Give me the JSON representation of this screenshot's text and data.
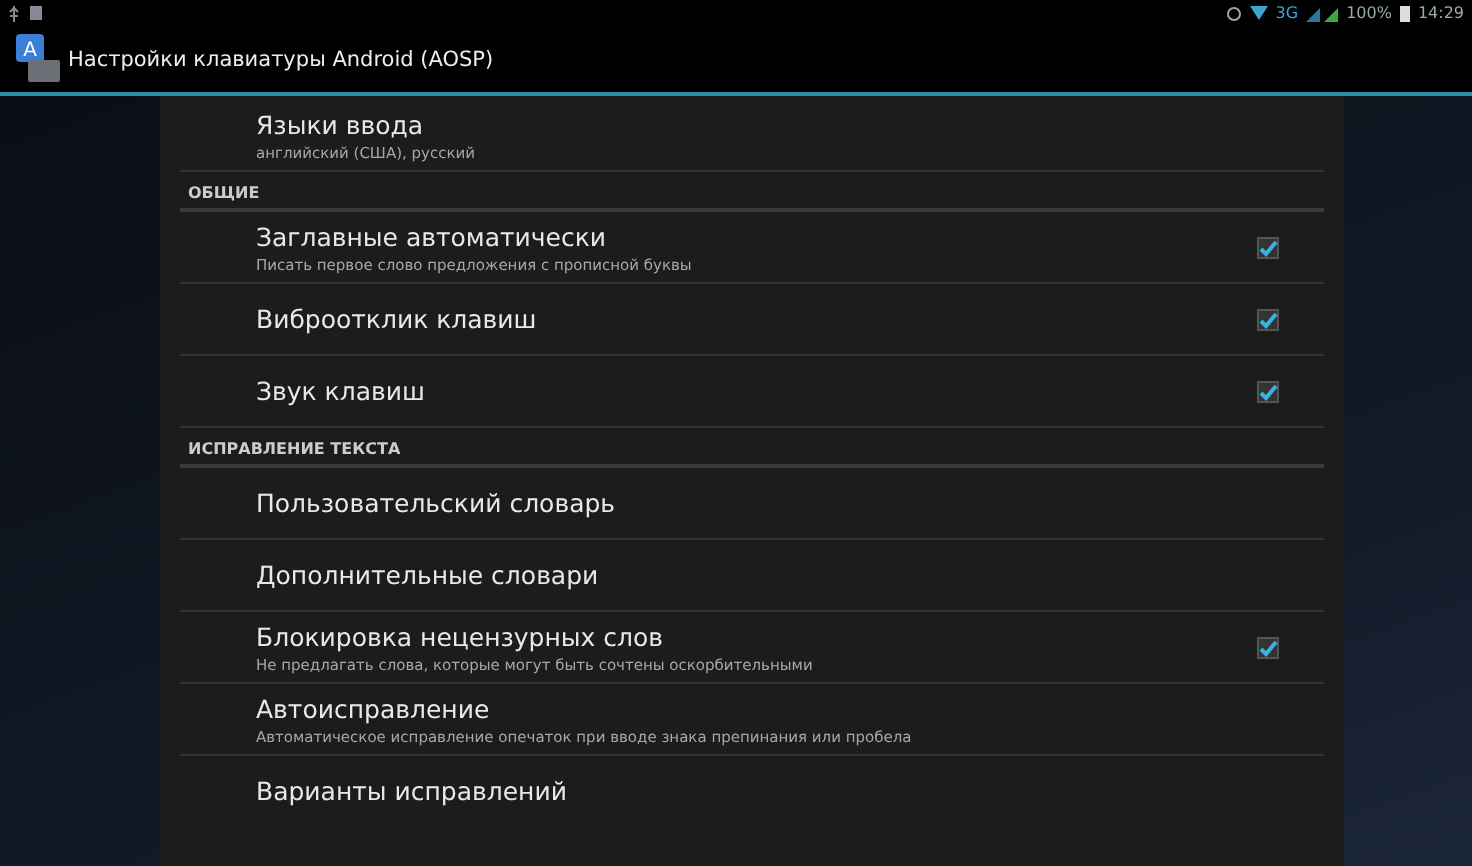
{
  "status_bar": {
    "network": "3G",
    "battery": "100%",
    "time": "14:29"
  },
  "action_bar": {
    "icon_letter": "A",
    "title": "Настройки клавиатуры Android (AOSP)"
  },
  "sections": [
    {
      "items": [
        {
          "kind": "plain",
          "title": "Языки ввода",
          "summary": "английский (США), русский"
        }
      ]
    },
    {
      "header": "ОБЩИЕ",
      "items": [
        {
          "kind": "checkbox",
          "title": "Заглавные автоматически",
          "summary": "Писать первое слово предложения с прописной буквы",
          "checked": true
        },
        {
          "kind": "checkbox",
          "title": "Виброотклик клавиш",
          "checked": true
        },
        {
          "kind": "checkbox",
          "title": "Звук клавиш",
          "checked": true
        }
      ]
    },
    {
      "header": "ИСПРАВЛЕНИЕ ТЕКСТА",
      "items": [
        {
          "kind": "plain",
          "title": "Пользовательский словарь"
        },
        {
          "kind": "plain",
          "title": "Дополнительные словари"
        },
        {
          "kind": "checkbox",
          "title": "Блокировка нецензурных слов",
          "summary": "Не предлагать слова, которые могут быть сочтены оскорбительными",
          "checked": true
        },
        {
          "kind": "plain",
          "title": "Автоисправление",
          "summary": "Автоматическое исправление опечаток при вводе знака препинания или пробела"
        },
        {
          "kind": "plain",
          "title": "Варианты исправлений"
        }
      ]
    }
  ]
}
